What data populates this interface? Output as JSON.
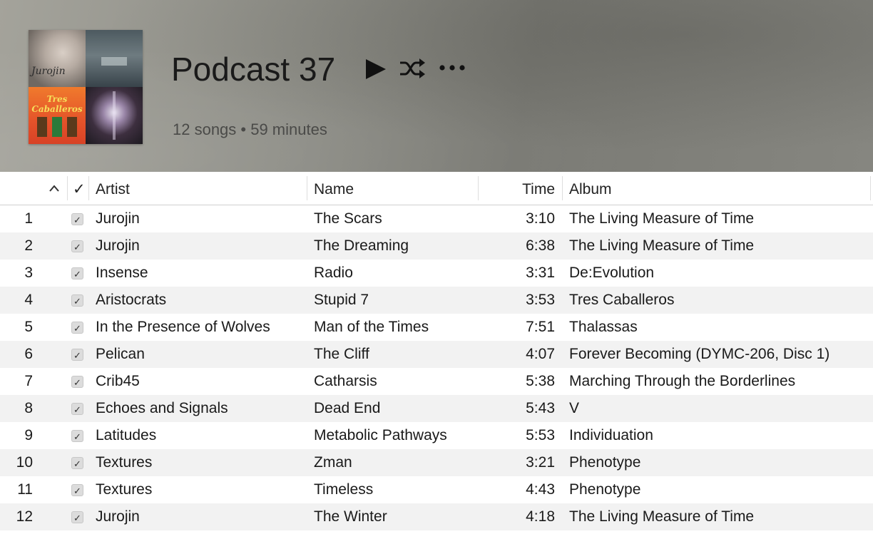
{
  "header": {
    "title": "Podcast 37",
    "subtitle": "12 songs • 59 minutes",
    "artwork": {
      "tile1_text": "Jurojin",
      "tile3_text": "Tres Caballeros"
    }
  },
  "icons": {
    "play": "play-icon",
    "shuffle": "shuffle-icon",
    "more": "more-icon",
    "sort": "sort-ascending-icon",
    "checkmark": "checkmark-icon"
  },
  "table": {
    "headers": {
      "sort_indicator": "^",
      "check": "✓",
      "artist": "Artist",
      "name": "Name",
      "time": "Time",
      "album": "Album"
    },
    "rows": [
      {
        "num": "1",
        "artist": "Jurojin",
        "name": "The Scars",
        "time": "3:10",
        "album": "The Living Measure of Time"
      },
      {
        "num": "2",
        "artist": "Jurojin",
        "name": "The Dreaming",
        "time": "6:38",
        "album": "The Living Measure of Time"
      },
      {
        "num": "3",
        "artist": "Insense",
        "name": "Radio",
        "time": "3:31",
        "album": "De:Evolution"
      },
      {
        "num": "4",
        "artist": "Aristocrats",
        "name": "Stupid 7",
        "time": "3:53",
        "album": "Tres Caballeros"
      },
      {
        "num": "5",
        "artist": "In the Presence of Wolves",
        "name": "Man of the Times",
        "time": "7:51",
        "album": "Thalassas"
      },
      {
        "num": "6",
        "artist": "Pelican",
        "name": "The Cliff",
        "time": "4:07",
        "album": "Forever Becoming (DYMC-206, Disc 1)"
      },
      {
        "num": "7",
        "artist": "Crib45",
        "name": "Catharsis",
        "time": "5:38",
        "album": "Marching Through the Borderlines"
      },
      {
        "num": "8",
        "artist": "Echoes and Signals",
        "name": "Dead End",
        "time": "5:43",
        "album": "V"
      },
      {
        "num": "9",
        "artist": "Latitudes",
        "name": "Metabolic Pathways",
        "time": "5:53",
        "album": "Individuation"
      },
      {
        "num": "10",
        "artist": "Textures",
        "name": "Zman",
        "time": "3:21",
        "album": "Phenotype"
      },
      {
        "num": "11",
        "artist": "Textures",
        "name": "Timeless",
        "time": "4:43",
        "album": "Phenotype"
      },
      {
        "num": "12",
        "artist": "Jurojin",
        "name": "The Winter",
        "time": "4:18",
        "album": "The Living Measure of Time"
      }
    ]
  }
}
